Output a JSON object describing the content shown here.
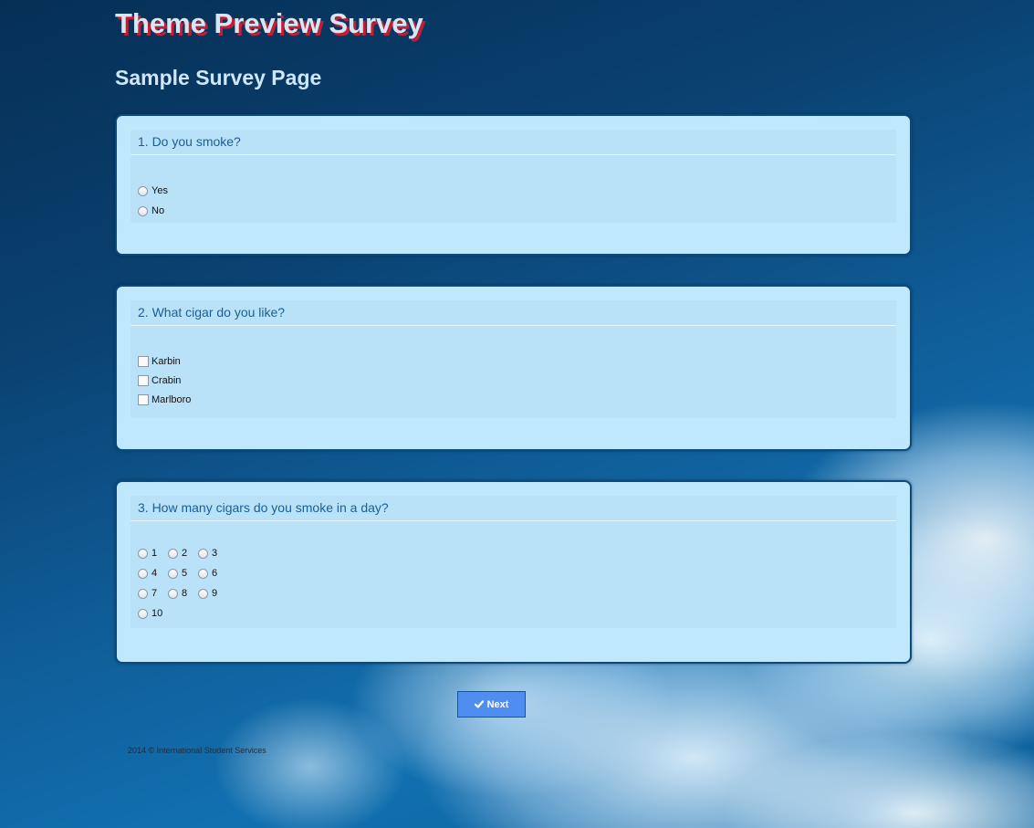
{
  "header": {
    "survey_title": "Theme Preview Survey",
    "page_title": "Sample Survey Page"
  },
  "questions": [
    {
      "title": "1. Do you smoke?",
      "type": "radio",
      "options": [
        "Yes",
        "No"
      ]
    },
    {
      "title": "2. What cigar do you like?",
      "type": "checkbox",
      "options": [
        "Karbin",
        "Crabin",
        "Marlboro"
      ]
    },
    {
      "title": "3. How many cigars do you smoke in a day?",
      "type": "radio",
      "options": [
        "1",
        "2",
        "3",
        "4",
        "5",
        "6",
        "7",
        "8",
        "9",
        "10"
      ]
    }
  ],
  "next_button": {
    "label": "Next",
    "icon": "check-icon"
  },
  "footer": {
    "copyright": "2014 © International Student Services"
  },
  "colors": {
    "title_shadow": "#c51d34",
    "panel_background": "#bfe8fc",
    "question_text": "#1a5f95",
    "button": "#4f8df0"
  }
}
